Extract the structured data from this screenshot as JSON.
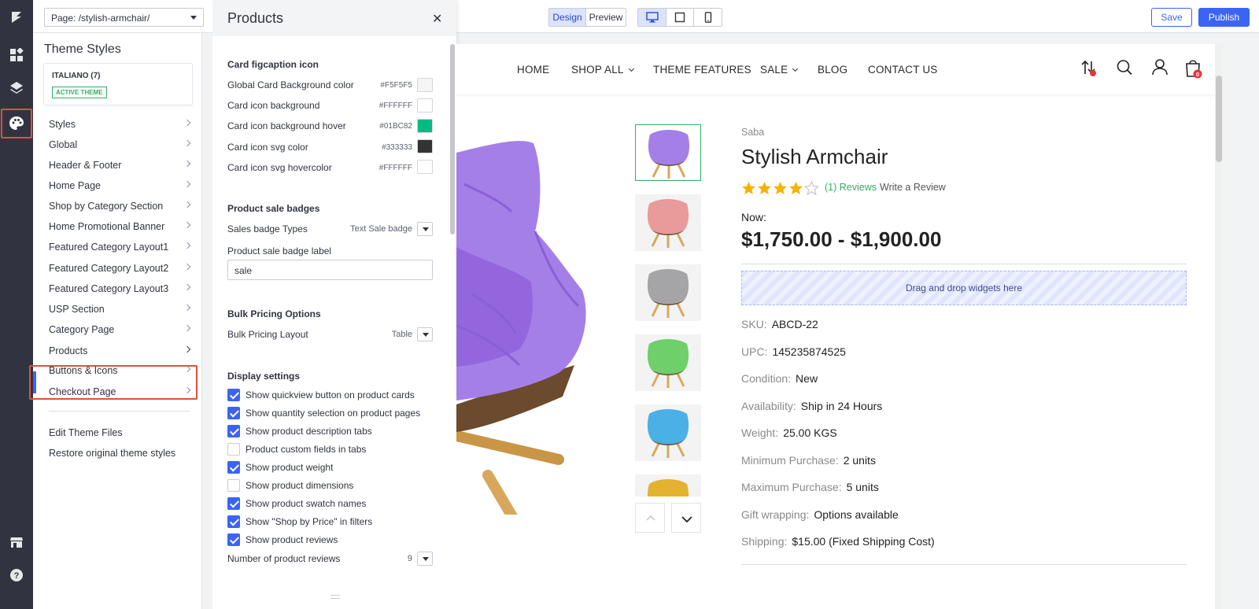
{
  "topbar": {
    "page_select": "Page: /stylish-armchair/",
    "view_modes": [
      "Design",
      "Preview"
    ],
    "save_label": "Save",
    "publish_label": "Publish"
  },
  "theme_panel": {
    "title": "Theme Styles",
    "theme_name": "ITALIANO (7)",
    "theme_badge": "ACTIVE THEME",
    "nav": [
      {
        "label": "Styles"
      },
      {
        "label": "Global"
      },
      {
        "label": "Header & Footer"
      },
      {
        "label": "Home Page"
      },
      {
        "label": "Shop by Category Section"
      },
      {
        "label": "Home Promotional Banner"
      },
      {
        "label": "Featured Category Layout1"
      },
      {
        "label": "Featured Category Layout2"
      },
      {
        "label": "Featured Category Layout3"
      },
      {
        "label": "USP Section"
      },
      {
        "label": "Category Page"
      },
      {
        "label": "Products"
      },
      {
        "label": "Buttons & Icons"
      },
      {
        "label": "Checkout Page"
      }
    ],
    "selected_item": "Products",
    "links": [
      "Edit Theme Files",
      "Restore original theme styles"
    ]
  },
  "products_panel": {
    "title": "Products",
    "card_section": {
      "title": "Card figcaption icon",
      "colors": [
        {
          "label": "Global Card Background color",
          "hex": "#F5F5F5",
          "color": "#F5F5F5"
        },
        {
          "label": "Card icon background",
          "hex": "#FFFFFF",
          "color": "#FFFFFF"
        },
        {
          "label": "Card icon background hover",
          "hex": "#01BC82",
          "color": "#01BC82"
        },
        {
          "label": "Card icon svg color",
          "hex": "#333333",
          "color": "#333333"
        },
        {
          "label": "Card icon svg hovercolor",
          "hex": "#FFFFFF",
          "color": "#FFFFFF"
        }
      ]
    },
    "sale_section": {
      "title": "Product sale badges",
      "badge_type_label": "Sales badge Types",
      "badge_type_value": "Text Sale badge",
      "badge_label_label": "Product sale badge label",
      "badge_label_value": "sale"
    },
    "bulk_section": {
      "title": "Bulk Pricing Options",
      "layout_label": "Bulk Pricing Layout",
      "layout_value": "Table"
    },
    "display_section": {
      "title": "Display settings",
      "options": [
        {
          "label": "Show quickview button on product cards",
          "checked": true
        },
        {
          "label": "Show quantity selection on product pages",
          "checked": true
        },
        {
          "label": "Show product description tabs",
          "checked": true
        },
        {
          "label": "Product custom fields in tabs",
          "checked": false
        },
        {
          "label": "Show product weight",
          "checked": true
        },
        {
          "label": "Show product dimensions",
          "checked": false
        },
        {
          "label": "Show product swatch names",
          "checked": true
        },
        {
          "label": "Show \"Shop by Price\" in filters",
          "checked": true
        },
        {
          "label": "Show product reviews",
          "checked": true
        }
      ],
      "reviews_count_label": "Number of product reviews",
      "reviews_count_value": "9"
    }
  },
  "preview": {
    "nav": [
      "HOME",
      "SHOP ALL",
      "THEME FEATURES",
      "SALE",
      "BLOG",
      "CONTACT US"
    ],
    "cart_count": "0",
    "product": {
      "brand": "Saba",
      "title": "Stylish Armchair",
      "rating": 4,
      "reviews_link": "(1) Reviews",
      "write_review": "Write a Review",
      "price_label": "Now:",
      "price": "$1,750.00 - $1,900.00",
      "dropzone": "Drag and drop widgets here",
      "specs": [
        {
          "key": "SKU:",
          "value": "ABCD-22"
        },
        {
          "key": "UPC:",
          "value": "145235874525"
        },
        {
          "key": "Condition:",
          "value": "New"
        },
        {
          "key": "Availability:",
          "value": "Ship in 24 Hours"
        },
        {
          "key": "Weight:",
          "value": "25.00 KGS"
        },
        {
          "key": "Minimum Purchase:",
          "value": "2 units"
        },
        {
          "key": "Maximum Purchase:",
          "value": "5 units"
        },
        {
          "key": "Gift wrapping:",
          "value": "Options available"
        },
        {
          "key": "Shipping:",
          "value": "$15.00 (Fixed Shipping Cost)"
        }
      ],
      "thumb_colors": [
        "#a57fe8",
        "#e99a9a",
        "#a5a5a8",
        "#6fcf6a",
        "#4ab0e6",
        "#e3b330"
      ]
    }
  },
  "colors": {
    "accent": "#3C64F4",
    "highlight": "#E0503C",
    "success": "#2EB061"
  }
}
